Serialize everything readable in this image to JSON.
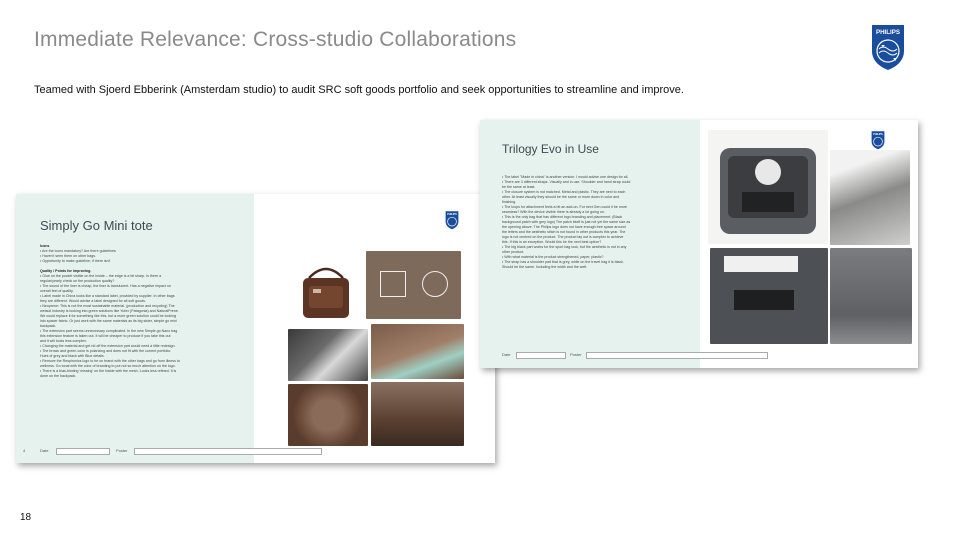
{
  "page": {
    "title": "Immediate Relevance:  Cross-studio Collaborations",
    "subtitle": "Teamed  with Sjoerd Ebberink (Amsterdam  studio) to audit SRC soft goods portfolio and seek opportunities to streamline and improve.",
    "page_number": "18",
    "logo_text": "PHILIPS"
  },
  "slides": [
    {
      "title": "Simply Go Mini tote",
      "logo_text": "PHILIPS",
      "bullets": [
        {
          "text": "Icons",
          "header": true
        },
        {
          "text": "•  Are the icons mandatory? Are there guidelines"
        },
        {
          "text": "•  Haven't seen them on other bags."
        },
        {
          "text": "•  Opportunity to make guideline, if there isn't"
        },
        {
          "text": ""
        },
        {
          "text": "Quality / Points for improving.",
          "header": true
        },
        {
          "text": "•  Glue on the pocket visible on the inside – the edge is a bit sharp. Is there a"
        },
        {
          "text": "    regular/yearly check on the production quality?"
        },
        {
          "text": "•  The sound of the liner is cheap, the liner is translucent. Has a negative impact on"
        },
        {
          "text": "    overall feel of quality."
        },
        {
          "text": "•  Label made in China looks like a standard label, provided by supplier. In other bags"
        },
        {
          "text": "    they are different. Would advise a label designed for all soft goods."
        },
        {
          "text": "•  Neoprene: This is not the most sustainable material. (production and recycling) The"
        },
        {
          "text": "    wetsuit industry is looking into green solutions like Yulex (Patagonia) and NaturalPrene."
        },
        {
          "text": "    We could replace it for something like this, but a more green solution could be looking"
        },
        {
          "text": "    into spacer fabric.  Or just work with the same materials as its big sister, simple go mini"
        },
        {
          "text": "    backpack."
        },
        {
          "text": "•  The extension part seems unnecessary complicated.  In the new Simple go Nano bag"
        },
        {
          "text": "    this extension feature is taken out. It will be cheaper to produce if you take this out"
        },
        {
          "text": "    and it will looks less complex."
        },
        {
          "text": "•  Changing the material and get rid off the extension part would need a little redesign."
        },
        {
          "text": "•  The brown and green color is polarizing and does not fit with the current portfolio:"
        },
        {
          "text": "    Hues of grey and black with Blue details."
        },
        {
          "text": "•  Remove the Respironics logo to be on brand with the other bags and go from illness to"
        },
        {
          "text": "    wellness. Go tonal with the color of branding to put not so much attention on the logo."
        },
        {
          "text": "•  There is a bias-binding 'missing' on the inside with the mesh. Looks less refined. It is"
        },
        {
          "text": "    done on the backpack."
        }
      ],
      "footer": {
        "page": "4",
        "date_label": "Date",
        "poster_label": "Poster"
      }
    },
    {
      "title": "Trilogy Evo in Use",
      "logo_text": "PHILIPS",
      "bullets": [
        {
          "text": "•  The label \"Made in china\" is another version. I would advise one design for all."
        },
        {
          "text": "•  There are 3 different straps. Visually and in use.  Shoulder and hand strap could"
        },
        {
          "text": "    be the same at least."
        },
        {
          "text": "•  The closure system is not matched.  Metal and plastic. They are next to each"
        },
        {
          "text": "    other. At least visually they should be the same or more down in color and"
        },
        {
          "text": "    finishing."
        },
        {
          "text": "•  The loops for attachment feels a bit an add-on. For next Gen could it be more"
        },
        {
          "text": "    seamless? With the device visible there is already  a lot going on."
        },
        {
          "text": "•  This is the only bag that has different logo branding and placement. (Black"
        },
        {
          "text": "    background patch with grey logo) The patch itself is just not yet the same size as"
        },
        {
          "text": "    the opening above. The Philips logo does not have enough free space around"
        },
        {
          "text": "    the letters and the aesthetic stitch is not found in other products this year. The"
        },
        {
          "text": "    logo is not centred on the product. The product lay out is complex to achieve"
        },
        {
          "text": "    this. If this is an exception. Would this be the next best option?"
        },
        {
          "text": "•  The big black part works for the sport bag look, but the aesthetic is not in any"
        },
        {
          "text": "    other product."
        },
        {
          "text": "•  With what material is the product strengthened, paper, plastic?"
        },
        {
          "text": "•  The strap has a shoulder pad that is grey, while on the travel bag it is black."
        },
        {
          "text": "    Should be the same. Including the width and the weft."
        }
      ],
      "footer": {
        "date_label": "Date",
        "poster_label": "Poster"
      }
    }
  ],
  "icons": [
    "philips-shield-icon"
  ],
  "colors": {
    "title_gray": "#8a8a8a",
    "philips_blue": "#1a4d9c",
    "panel_mint": "#e6f2ee"
  }
}
